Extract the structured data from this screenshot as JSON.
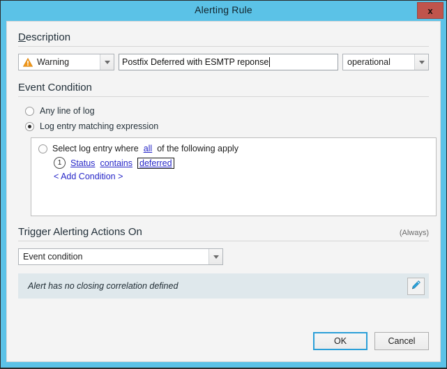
{
  "window": {
    "title": "Alerting Rule",
    "close_label": "x",
    "accent_color": "#5bc2e7",
    "close_color": "#c0544c"
  },
  "description_section": {
    "title": "Description",
    "access_key": "D",
    "severity": {
      "value": "Warning",
      "icon": "warning-triangle-icon",
      "icon_color": "#f0971a"
    },
    "description_field": {
      "value": "Postfix Deferred with ESMTP reponse",
      "placeholder": ""
    },
    "channel": {
      "value": "operational"
    }
  },
  "event_condition_section": {
    "title": "Event Condition",
    "options": [
      {
        "label": "Any line of log",
        "checked": false
      },
      {
        "label": "Log entry matching expression",
        "checked": true
      }
    ],
    "expression": {
      "select_checked": false,
      "prefix": "Select log entry where",
      "match_link": "all",
      "suffix": "of the following apply",
      "conditions": [
        {
          "number": "1",
          "field": "Status",
          "operator": "contains",
          "value": "deferred",
          "focused": true
        }
      ],
      "add_condition_label": "< Add Condition >"
    }
  },
  "trigger_section": {
    "title": "Trigger Alerting Actions On",
    "note": "(Always)",
    "trigger": {
      "value": "Event condition"
    }
  },
  "correlation": {
    "message": "Alert has no closing correlation defined",
    "edit_icon": "pencil-icon",
    "edit_icon_color": "#1f9fd4"
  },
  "footer": {
    "ok_label": "OK",
    "cancel_label": "Cancel"
  }
}
